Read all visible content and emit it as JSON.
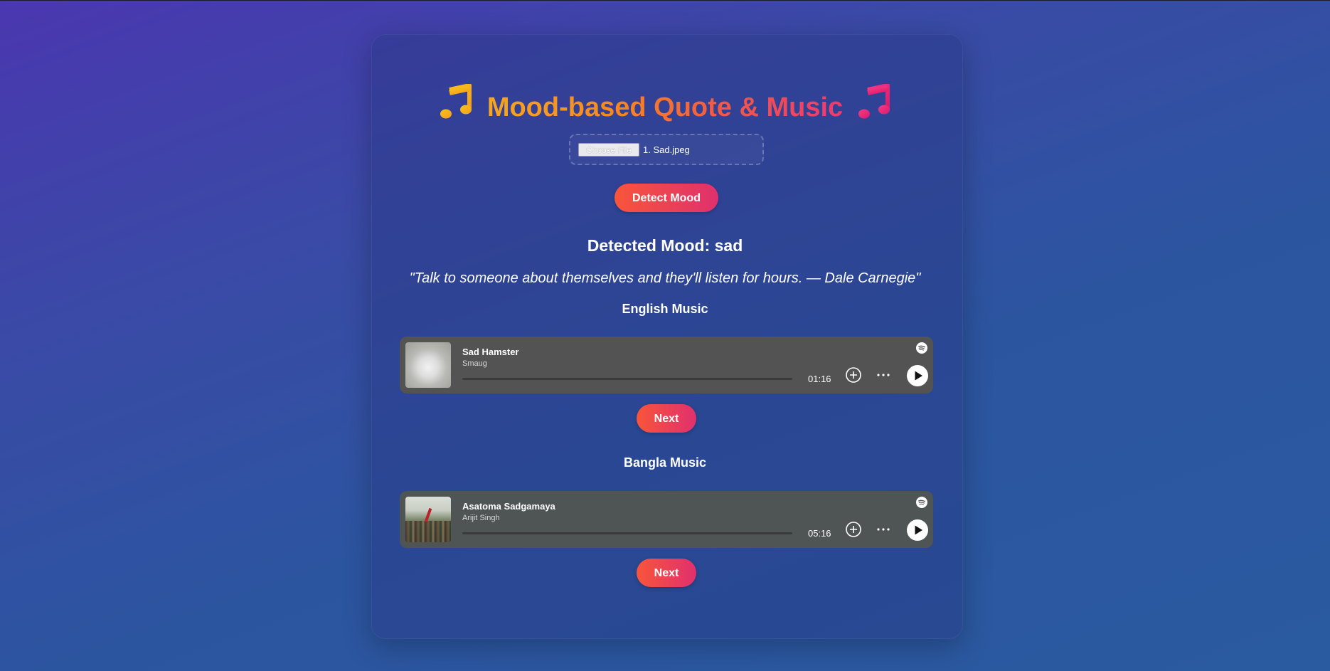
{
  "header": {
    "title_left_icon": "music-note-icon",
    "title": "Mood-based Quote & Music",
    "title_right_icon": "music-note-icon"
  },
  "upload": {
    "choose_label": "Choose File",
    "file_name": "1. Sad.jpeg"
  },
  "actions": {
    "detect_label": "Detect Mood"
  },
  "result": {
    "mood_heading": "Detected Mood: sad",
    "quote": "\"Talk to someone about themselves and they'll listen for hours. — Dale Carnegie\""
  },
  "sections": [
    {
      "heading": "English Music",
      "track": {
        "title": "Sad Hamster",
        "artist": "Smaug",
        "duration": "01:16",
        "progress": 0
      },
      "next_label": "Next"
    },
    {
      "heading": "Bangla Music",
      "track": {
        "title": "Asatoma Sadgamaya",
        "artist": "Arijit Singh",
        "duration": "05:16",
        "progress": 0
      },
      "next_label": "Next"
    }
  ],
  "colors": {
    "accent_start": "#f8553a",
    "accent_end": "#e0306e",
    "title_gold": "#f5a623",
    "title_pink": "#ee3a6f",
    "player_bg": "#535353"
  }
}
